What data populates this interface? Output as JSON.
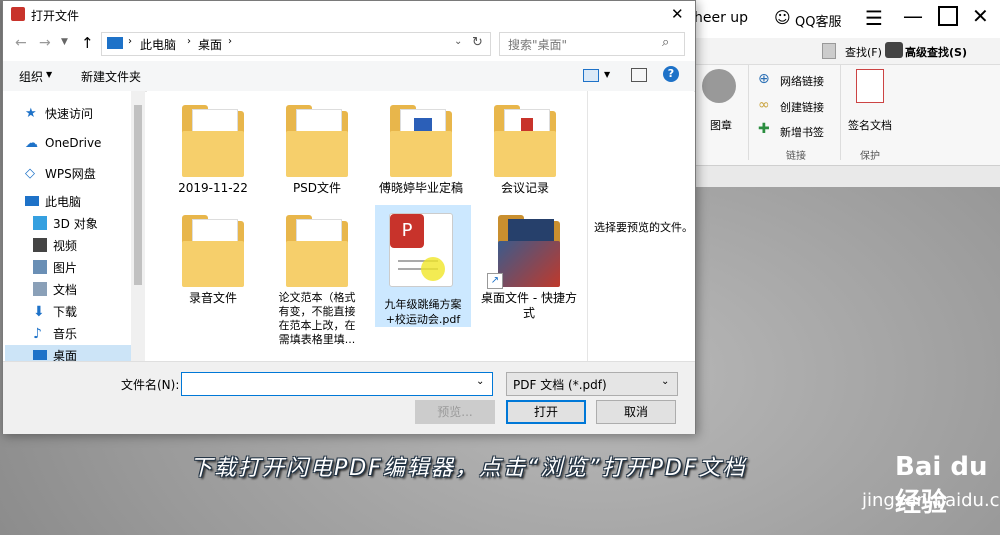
{
  "background_app": {
    "title_fragment": "heer up",
    "qq_service": "QQ客服",
    "find_label": "查找(F)",
    "advanced_find_label": "高级查找(S)",
    "ribbon": {
      "partial_label": "图章",
      "network_link": "网络链接",
      "create_link": "创建链接",
      "new_bookmark": "新增书签",
      "group_link": "链接",
      "sign_document": "签名文档",
      "group_protect": "保护"
    }
  },
  "dialog": {
    "title": "打开文件",
    "close_glyph": "✕",
    "breadcrumb": [
      "此电脑",
      "桌面"
    ],
    "search_placeholder": "搜索\"桌面\"",
    "toolbar": {
      "organize": "组织",
      "new_folder": "新建文件夹"
    },
    "nav": [
      {
        "label": "快速访问",
        "icon": "star-icon"
      },
      {
        "label": "OneDrive",
        "icon": "cloud-icon"
      },
      {
        "label": "WPS网盘",
        "icon": "wps-cloud-icon"
      },
      {
        "label": "此电脑",
        "icon": "computer-icon"
      },
      {
        "label": "3D 对象",
        "icon": "cube-icon"
      },
      {
        "label": "视频",
        "icon": "video-icon"
      },
      {
        "label": "图片",
        "icon": "picture-icon"
      },
      {
        "label": "文档",
        "icon": "document-icon"
      },
      {
        "label": "下载",
        "icon": "download-icon"
      },
      {
        "label": "音乐",
        "icon": "music-icon"
      },
      {
        "label": "桌面",
        "icon": "desktop-icon"
      }
    ],
    "files": [
      {
        "name": "2019-11-22",
        "type": "folder"
      },
      {
        "name": "PSD文件",
        "type": "folder"
      },
      {
        "name": "傅晓婷毕业定稿",
        "type": "folder"
      },
      {
        "name": "会议记录",
        "type": "folder"
      },
      {
        "name": "录音文件",
        "type": "folder"
      },
      {
        "name": "论文范本（格式有变，不能直接在范本上改，在需填表格里填...",
        "type": "folder"
      },
      {
        "name": "九年级跳绳方案+校运动会.pdf",
        "type": "pdf"
      },
      {
        "name": "桌面文件 - 快捷方式",
        "type": "shortcut"
      }
    ],
    "preview_text": "选择要预览的文件。",
    "filename_label": "文件名(N):",
    "filename_value": "",
    "filetype_value": "PDF 文档 (*.pdf)",
    "buttons": {
      "preview": "预览...",
      "open": "打开",
      "cancel": "取消"
    }
  },
  "caption": "下载打开闪电PDF编辑器，点击“浏览”打开PDF文档",
  "watermark": {
    "brand": "Bai du 经验",
    "site": "jingyan.baidu.com"
  },
  "colors": {
    "accent": "#0078d7",
    "pdf_red": "#c8332b",
    "folder": "#f6cf6b"
  }
}
